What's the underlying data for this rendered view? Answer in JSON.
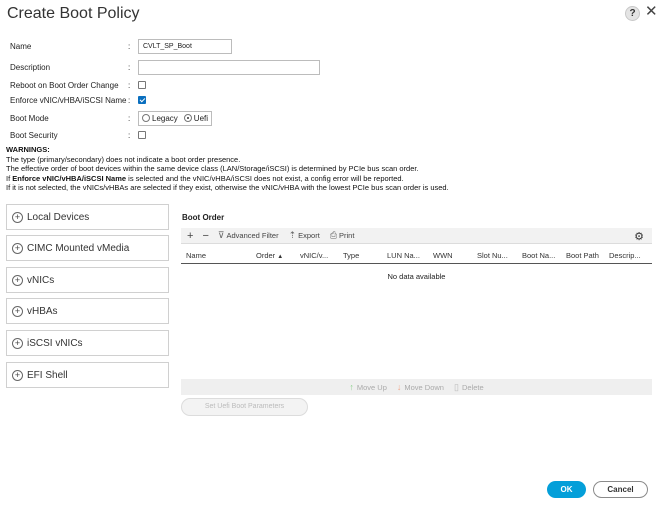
{
  "dialog": {
    "title": "Create Boot Policy",
    "help_label": "?",
    "close_label": "✕"
  },
  "form": {
    "name": {
      "label": "Name",
      "colon": ":",
      "value": "CVLT_SP_Boot"
    },
    "description": {
      "label": "Description",
      "colon": ":",
      "value": ""
    },
    "reboot": {
      "label": "Reboot on Boot Order Change",
      "colon": ":",
      "checked": false
    },
    "enforce": {
      "label": "Enforce vNIC/vHBA/iSCSI Name",
      "colon": ":",
      "checked": true
    },
    "boot_mode": {
      "label": "Boot Mode",
      "colon": ":",
      "options": [
        "Legacy",
        "Uefi"
      ],
      "selected": "Uefi"
    },
    "boot_security": {
      "label": "Boot Security",
      "colon": ":",
      "checked": false
    }
  },
  "warnings": {
    "title": "WARNINGS:",
    "line1": "The type (primary/secondary) does not indicate a boot order presence.",
    "line2": "The effective order of boot devices within the same device class (LAN/Storage/iSCSI) is determined by PCIe bus scan order.",
    "line3_prefix": "If ",
    "line3_bold": "Enforce vNIC/vHBA/iSCSI Name",
    "line3_suffix": " is selected and the vNIC/vHBA/iSCSI does not exist, a config error will be reported.",
    "line4": "If it is not selected, the vNICs/vHBAs are selected if they exist, otherwise the vNIC/vHBA with the lowest PCIe bus scan order is used."
  },
  "devices": [
    {
      "label": "Local Devices"
    },
    {
      "label": "CIMC Mounted vMedia"
    },
    {
      "label": "vNICs"
    },
    {
      "label": "vHBAs"
    },
    {
      "label": "iSCSI vNICs"
    },
    {
      "label": "EFI Shell"
    }
  ],
  "boot_order": {
    "title": "Boot Order",
    "toolbar": {
      "add": "+",
      "remove": "−",
      "filter": "Advanced Filter",
      "export": "Export",
      "print": "Print"
    },
    "columns": [
      "Name",
      "Order",
      "vNIC/v...",
      "Type",
      "LUN Na...",
      "WWN",
      "Slot Nu...",
      "Boot Na...",
      "Boot Path",
      "Descrip..."
    ],
    "sort_indicator": "▲",
    "empty_text": "No data available",
    "actions": {
      "move_up": "Move Up",
      "move_down": "Move Down",
      "delete": "Delete"
    },
    "uefi_button": "Set Uefi Boot Parameters"
  },
  "footer": {
    "ok": "OK",
    "cancel": "Cancel"
  },
  "colors": {
    "accent": "#049fd9",
    "checkbox": "#0a6fbf"
  }
}
